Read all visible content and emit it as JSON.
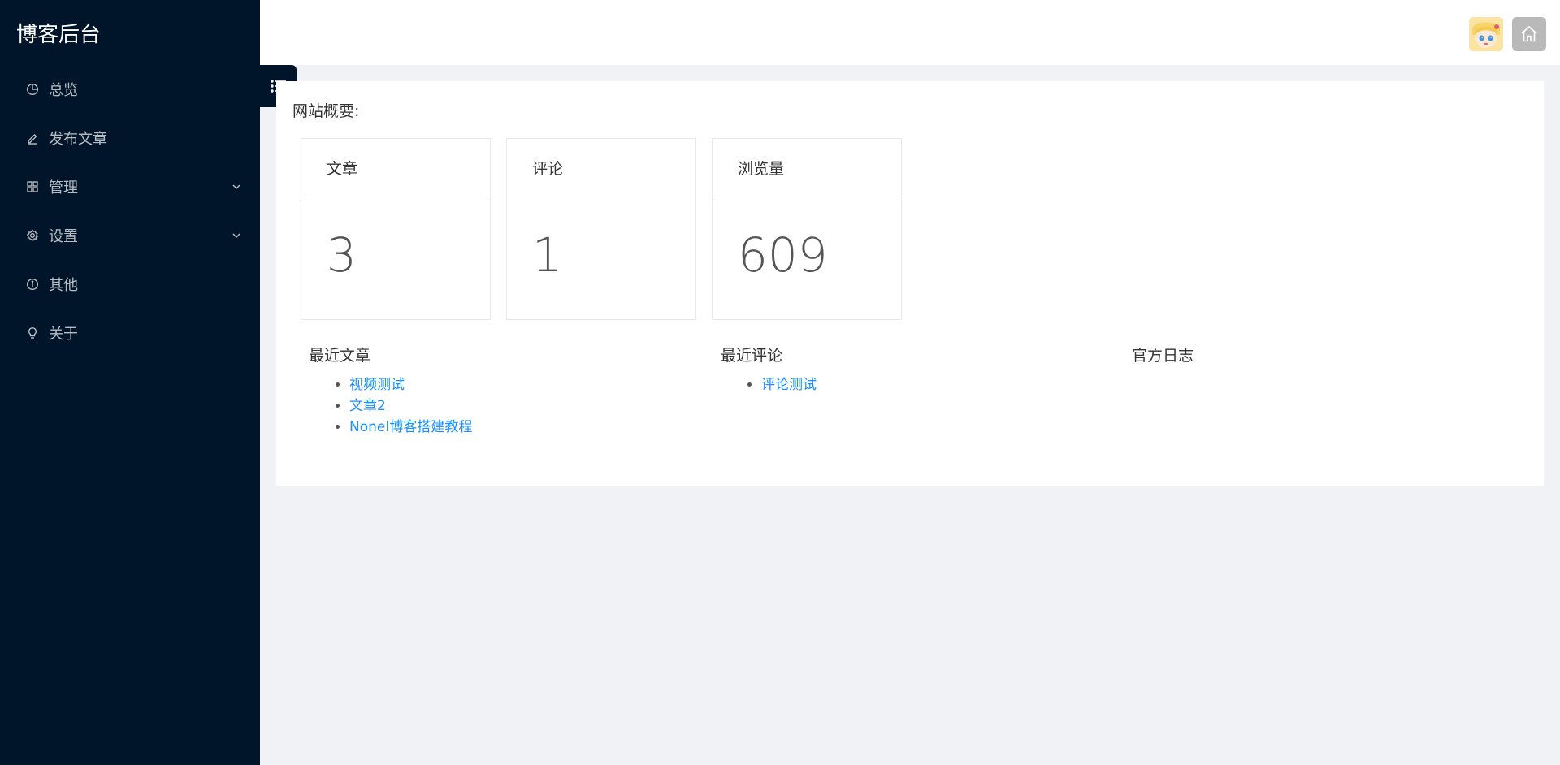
{
  "app": {
    "title": "博客后台"
  },
  "sidebar": {
    "items": [
      {
        "label": "总览",
        "icon": "pie-chart-icon"
      },
      {
        "label": "发布文章",
        "icon": "edit-icon"
      },
      {
        "label": "管理",
        "icon": "grid-icon",
        "has_submenu": true
      },
      {
        "label": "设置",
        "icon": "gear-icon",
        "has_submenu": true
      },
      {
        "label": "其他",
        "icon": "info-icon"
      },
      {
        "label": "关于",
        "icon": "bulb-icon"
      }
    ]
  },
  "header": {
    "avatar_icon": "user-avatar",
    "home_icon": "home-icon"
  },
  "main": {
    "overview_title": "网站概要:",
    "stats": [
      {
        "label": "文章",
        "value": "3"
      },
      {
        "label": "评论",
        "value": "1"
      },
      {
        "label": "浏览量",
        "value": "609"
      }
    ],
    "recent_posts": {
      "title": "最近文章",
      "items": [
        "视频测试",
        "文章2",
        "NoneI博客搭建教程"
      ]
    },
    "recent_comments": {
      "title": "最近评论",
      "items": [
        "评论测试"
      ]
    },
    "official_log": {
      "title": "官方日志"
    }
  },
  "colors": {
    "sidebar_bg": "#001529",
    "page_bg": "#f0f2f5",
    "link": "#1890ff"
  }
}
